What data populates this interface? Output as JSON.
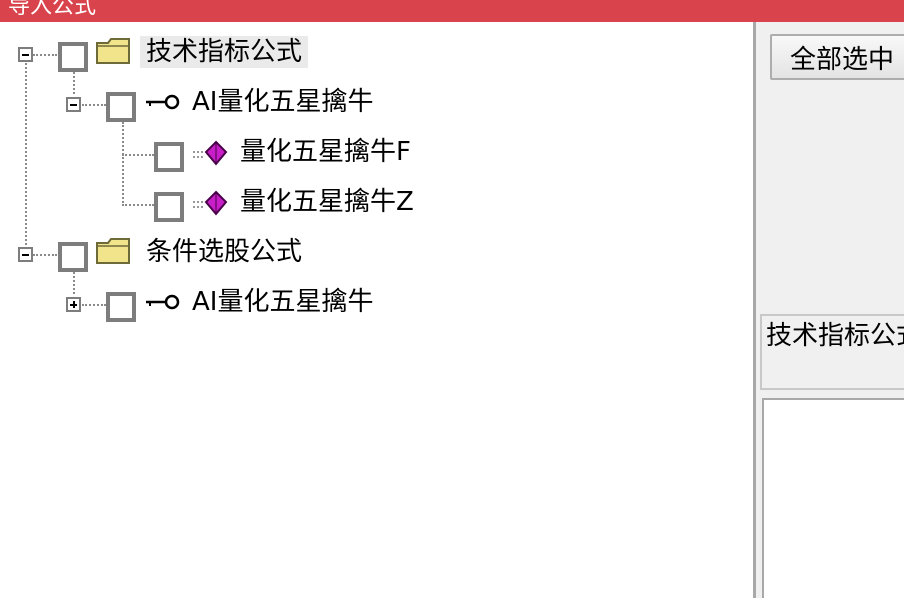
{
  "window": {
    "title": "导入公式"
  },
  "tree": {
    "nodes": [
      {
        "label": "技术指标公式",
        "selected": true,
        "expanded": true,
        "icon": "folder-icon"
      },
      {
        "label": "AI量化五星擒牛",
        "expanded": true,
        "icon": "key-icon"
      },
      {
        "label": "量化五星擒牛F",
        "icon": "gem-icon"
      },
      {
        "label": "量化五星擒牛Z",
        "icon": "gem-icon"
      },
      {
        "label": "条件选股公式",
        "expanded": true,
        "icon": "folder-icon"
      },
      {
        "label": "AI量化五星擒牛",
        "expanded": false,
        "icon": "key-icon"
      }
    ]
  },
  "right_panel": {
    "select_all_label": "全部选中",
    "category_text": "技术指标公式"
  },
  "colors": {
    "titlebar": "#d9434b",
    "folder": "#f2e48a",
    "gem": "#c81ec8"
  }
}
